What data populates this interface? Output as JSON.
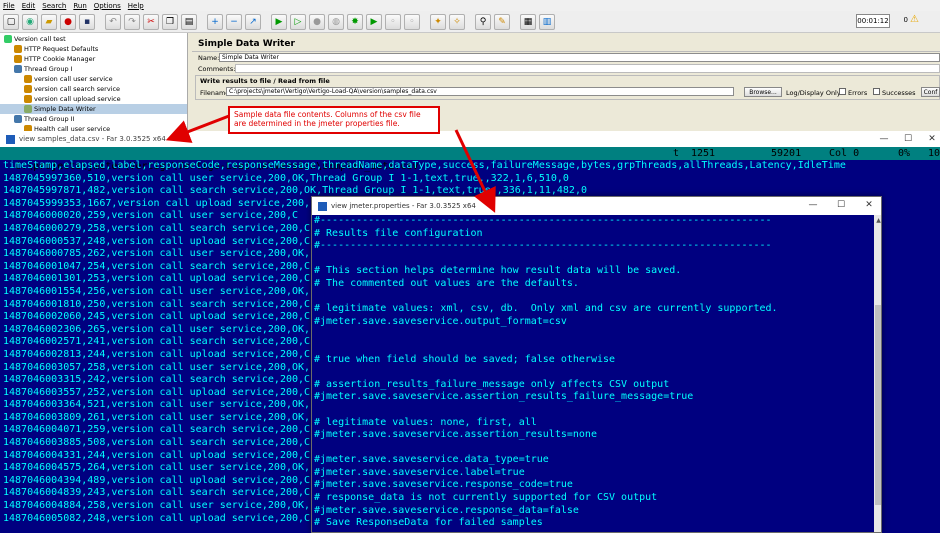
{
  "menubar": [
    "File",
    "Edit",
    "Search",
    "Run",
    "Options",
    "Help"
  ],
  "toolbar": {
    "timer": "00:01:12",
    "error_count": "0"
  },
  "tree": [
    {
      "label": "Version call test",
      "indent": 0
    },
    {
      "label": "HTTP Request Defaults",
      "indent": 1
    },
    {
      "label": "HTTP Cookie Manager",
      "indent": 1
    },
    {
      "label": "Thread Group I",
      "indent": 1
    },
    {
      "label": "version call user service",
      "indent": 2
    },
    {
      "label": "version call search service",
      "indent": 2
    },
    {
      "label": "version call upload service",
      "indent": 2
    },
    {
      "label": "Simple Data Writer",
      "indent": 2,
      "selected": true
    },
    {
      "label": "Thread Group II",
      "indent": 1
    },
    {
      "label": "Health call user service",
      "indent": 2
    }
  ],
  "panel": {
    "title": "Simple Data Writer",
    "name_label": "Name:",
    "name_value": "Simple Data Writer",
    "comments_label": "Comments:",
    "section_label": "Write results to file / Read from file",
    "filename_label": "Filename",
    "filename_value": "C:\\projects\\jmeter\\Vertigo\\Vertigo-Load-QA\\version\\samples_data.csv",
    "browse": "Browse...",
    "log_display": "Log/Display Only:",
    "errors": "Errors",
    "successes": "Successes",
    "configure": "Conf"
  },
  "far1": {
    "title": "view samples_data.csv - Far 3.0.3525 x64",
    "path": "C:\\projects\\jmeter\\Vertigo\\Vertigo-Load-QA\\version\\samples_data.csv",
    "status_t": "t",
    "status_size": "1251",
    "status_pos": "59201",
    "status_col": "Col 0",
    "status_pct": "0%",
    "status_right": "10",
    "lines": [
      "timeStamp,elapsed,label,responseCode,responseMessage,threadName,dataType,success,failureMessage,bytes,grpThreads,allThreads,Latency,IdleTime",
      "1487045997360,510,version call user service,200,OK,Thread Group I 1-1,text,true,,322,1,6,510,0",
      "1487045997871,482,version call search service,200,OK,Thread Group I 1-1,text,true,,336,1,11,482,0",
      "1487045999353,1667,version call upload service,200,",
      "1487046000020,259,version call user service,200,C",
      "1487046000279,258,version call search service,200,C",
      "1487046000537,248,version call upload service,200,C",
      "1487046000785,262,version call user service,200,OK,",
      "1487046001047,254,version call search service,200,C",
      "1487046001301,253,version call upload service,200,C",
      "1487046001554,256,version call user service,200,OK,",
      "1487046001810,250,version call search service,200,C",
      "1487046002060,245,version call upload service,200,C",
      "1487046002306,265,version call user service,200,OK,",
      "1487046002571,241,version call search service,200,C",
      "1487046002813,244,version call upload service,200,C",
      "1487046003057,258,version call user service,200,OK,",
      "1487046003315,242,version call search service,200,C",
      "1487046003557,252,version call upload service,200,C",
      "1487046003364,521,version call user service,200,OK,",
      "1487046003809,261,version call user service,200,OK,",
      "1487046004071,259,version call search service,200,C",
      "1487046003885,508,version call search service,200,C",
      "1487046004331,244,version call upload service,200,C",
      "1487046004575,264,version call user service,200,OK,",
      "1487046004394,489,version call upload service,200,C",
      "1487046004839,243,version call search service,200,C",
      "1487046004884,258,version call user service,200,OK,",
      "1487046005082,248,version call upload service,200,C"
    ]
  },
  "far2": {
    "title": "view jmeter.properties - Far 3.0.3525 x64",
    "lines": [
      "#---------------------------------------------------------------------------",
      "# Results file configuration",
      "#---------------------------------------------------------------------------",
      "",
      "# This section helps determine how result data will be saved.",
      "# The commented out values are the defaults.",
      "",
      "# legitimate values: xml, csv, db.  Only xml and csv are currently supported.",
      "#jmeter.save.saveservice.output_format=csv",
      "",
      "",
      "# true when field should be saved; false otherwise",
      "",
      "# assertion_results_failure_message only affects CSV output",
      "#jmeter.save.saveservice.assertion_results_failure_message=true",
      "",
      "# legitimate values: none, first, all",
      "#jmeter.save.saveservice.assertion_results=none",
      "",
      "#jmeter.save.saveservice.data_type=true",
      "#jmeter.save.saveservice.label=true",
      "#jmeter.save.saveservice.response_code=true",
      "# response_data is not currently supported for CSV output",
      "#jmeter.save.saveservice.response_data=false",
      "# Save ResponseData for failed samples"
    ]
  },
  "callout": "Sample data file contents. Columns of the csv file are determined in the jmeter properties file."
}
